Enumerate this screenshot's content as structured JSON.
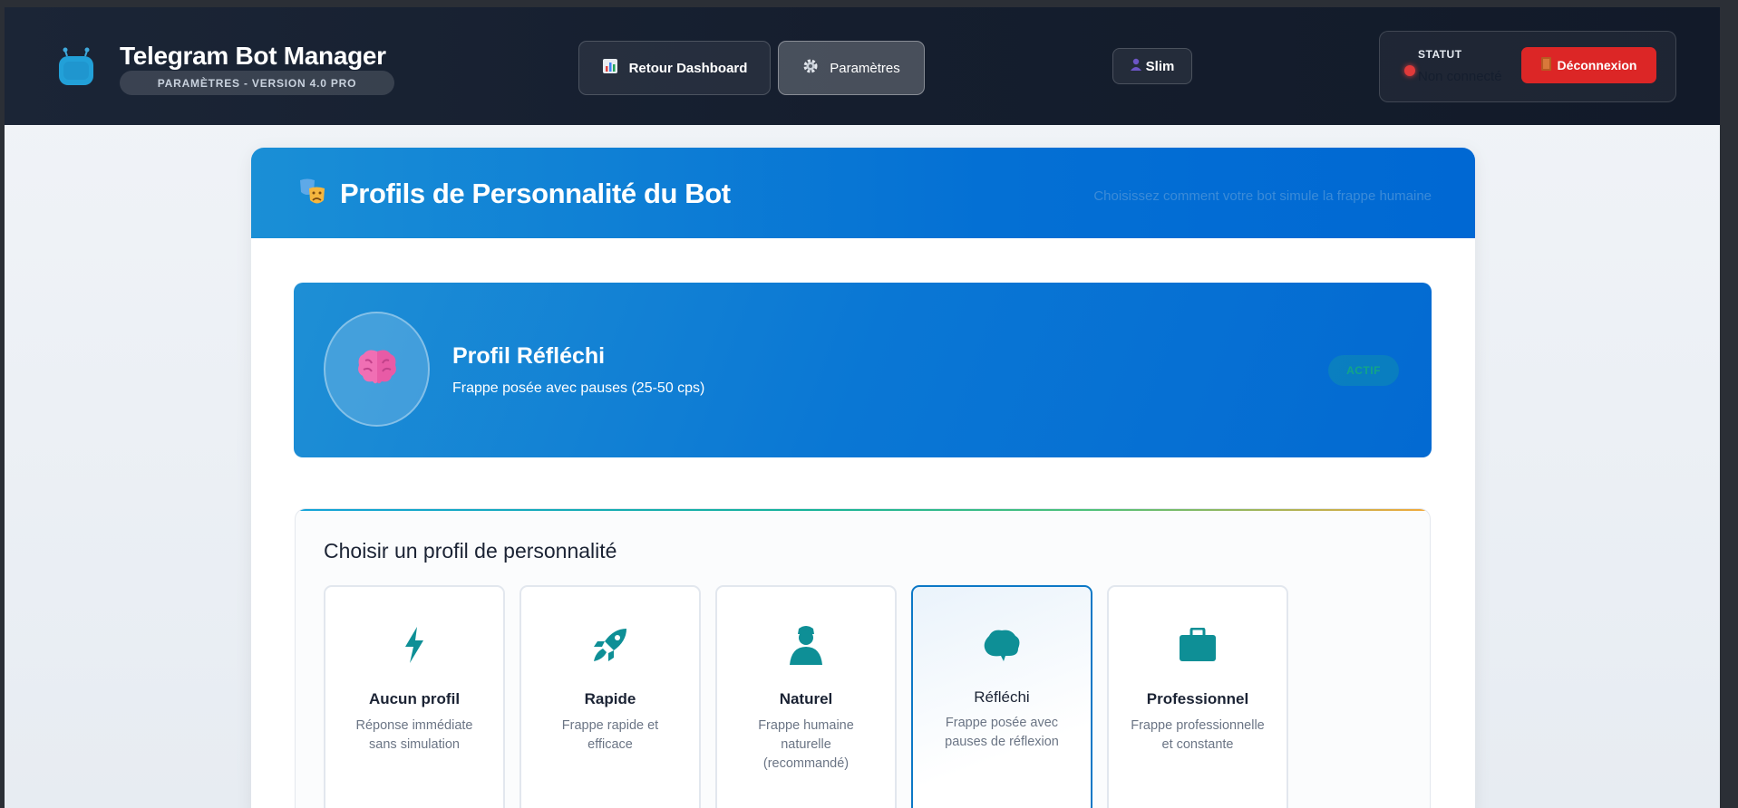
{
  "header": {
    "title": "Telegram Bot Manager",
    "subtitle": "PARAMÈTRES - VERSION 4.0 PRO",
    "nav": {
      "dashboard_label": "Retour Dashboard",
      "settings_label": "Paramètres"
    },
    "user": {
      "name": "Slim"
    },
    "status": {
      "label": "STATUT",
      "value": "Non connecté",
      "color": "#e03a3a"
    },
    "logout_label": "Déconnexion"
  },
  "panel": {
    "title": "Profils de Personnalité du Bot",
    "hint": "Choisissez comment votre bot simule la frappe humaine",
    "active_profile": {
      "title": "Profil Réfléchi",
      "description": "Frappe posée avec pauses (25-50 cps)",
      "badge": "ACTIF"
    },
    "selector": {
      "title": "Choisir un profil de personnalité",
      "profiles": [
        {
          "icon": "lightning-icon",
          "name": "Aucun profil",
          "description": "Réponse immédiate sans simulation",
          "selected": false
        },
        {
          "icon": "rocket-icon",
          "name": "Rapide",
          "description": "Frappe rapide et efficace",
          "selected": false
        },
        {
          "icon": "user-icon",
          "name": "Naturel",
          "description": "Frappe humaine naturelle (recommandé)",
          "selected": false
        },
        {
          "icon": "brain-icon",
          "name": "Réfléchi",
          "description": "Frappe posée avec pauses de réflexion",
          "selected": true
        },
        {
          "icon": "briefcase-icon",
          "name": "Professionnel",
          "description": "Frappe professionnelle et constante",
          "selected": false
        }
      ]
    }
  },
  "colors": {
    "accent": "#0470d4",
    "icon_teal": "#0e8f96",
    "danger": "#dc2626"
  }
}
